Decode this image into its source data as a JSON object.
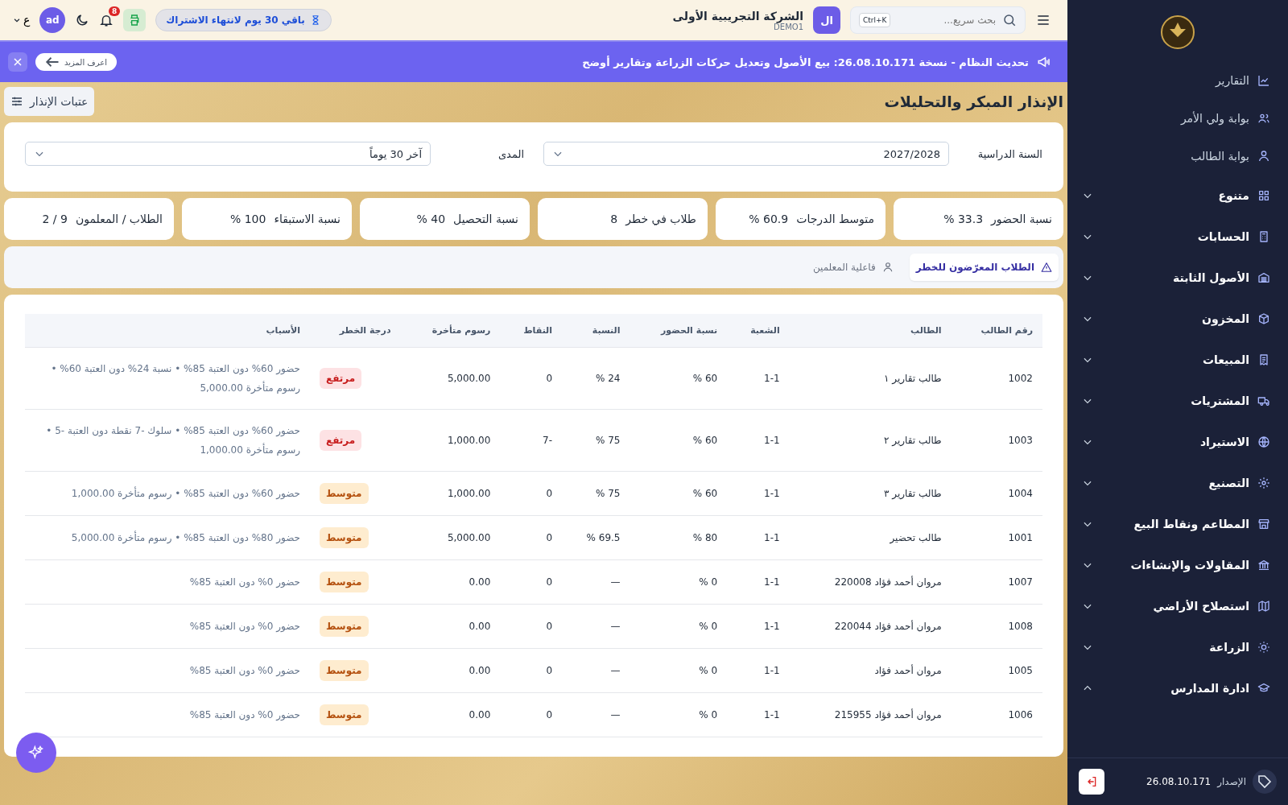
{
  "topbar": {
    "search": {
      "placeholder": "بحث سريع...",
      "shortcut": "Ctrl+K"
    },
    "company": {
      "initials": "ال",
      "name": "الشركة التجريبية الأولى",
      "code": "DEMO1"
    },
    "subscription": "باقي 30 يوم لانتهاء الاشتراك",
    "notifications": "8",
    "user": "ad",
    "language": "ع"
  },
  "banner": {
    "text": "تحديث النظام - نسخة 26.08.10.171: بيع الأصول وتعديل حركات الزراعة وتقارير أوضح",
    "more": "اعرف المزيد"
  },
  "page": {
    "title": "الإنذار المبكر والتحليلات",
    "thresholds_button": "عتبات الإنذار"
  },
  "filters": [
    {
      "label": "السنة الدراسية",
      "value": "2027/2028"
    },
    {
      "label": "المدى",
      "value": "آخر 30 يوماً"
    }
  ],
  "kpis": [
    {
      "label": "نسبة الحضور",
      "value": "33.3 %"
    },
    {
      "label": "متوسط الدرجات",
      "value": "60.9 %"
    },
    {
      "label": "طلاب في خطر",
      "value": "8"
    },
    {
      "label": "نسبة التحصيل",
      "value": "40 %"
    },
    {
      "label": "نسبة الاستبقاء",
      "value": "100 %"
    },
    {
      "label": "الطلاب / المعلمون",
      "value": "9 / 2"
    }
  ],
  "tabs": [
    {
      "label": "الطلاب المعرّضون للخطر",
      "selected": true,
      "kind": "warning"
    },
    {
      "label": "فاعلية المعلمين",
      "selected": false,
      "kind": "person"
    }
  ],
  "table": {
    "columns": [
      "رقم الطالب",
      "الطالب",
      "الشعبة",
      "نسبة الحضور",
      "النسبة",
      "النقاط",
      "رسوم متأخرة",
      "درجة الخطر",
      "الأسباب"
    ],
    "rows": [
      {
        "id": "1002",
        "student": "طالب تقارير ١",
        "section": "1-1",
        "attendance": "60 %",
        "ratio": "24 %",
        "points": "0",
        "late_fees": "5,000.00",
        "risk": {
          "label": "مرتفع",
          "kind": "high"
        },
        "reasons": "حضور 60% دون العتبة 85% • نسبة 24% دون العتبة 60% • رسوم متأخرة 5,000.00"
      },
      {
        "id": "1003",
        "student": "طالب تقارير ٢",
        "section": "1-1",
        "attendance": "60 %",
        "ratio": "75 %",
        "points": "-7",
        "late_fees": "1,000.00",
        "risk": {
          "label": "مرتفع",
          "kind": "high"
        },
        "reasons": "حضور 60% دون العتبة 85% • سلوك -7 نقطة دون العتبة -5 • رسوم متأخرة 1,000.00"
      },
      {
        "id": "1004",
        "student": "طالب تقارير ٣",
        "section": "1-1",
        "attendance": "60 %",
        "ratio": "75 %",
        "points": "0",
        "late_fees": "1,000.00",
        "risk": {
          "label": "متوسط",
          "kind": "medium"
        },
        "reasons": "حضور 60% دون العتبة 85% • رسوم متأخرة 1,000.00"
      },
      {
        "id": "1001",
        "student": "طالب تحضير",
        "section": "1-1",
        "attendance": "80 %",
        "ratio": "69.5 %",
        "points": "0",
        "late_fees": "5,000.00",
        "risk": {
          "label": "متوسط",
          "kind": "medium"
        },
        "reasons": "حضور 80% دون العتبة 85% • رسوم متأخرة 5,000.00"
      },
      {
        "id": "1007",
        "student": "مروان أحمد فؤاد 220008",
        "section": "1-1",
        "attendance": "0 %",
        "ratio": "—",
        "points": "0",
        "late_fees": "0.00",
        "risk": {
          "label": "متوسط",
          "kind": "medium"
        },
        "reasons": "حضور 0% دون العتبة 85%"
      },
      {
        "id": "1008",
        "student": "مروان أحمد فؤاد 220044",
        "section": "1-1",
        "attendance": "0 %",
        "ratio": "—",
        "points": "0",
        "late_fees": "0.00",
        "risk": {
          "label": "متوسط",
          "kind": "medium"
        },
        "reasons": "حضور 0% دون العتبة 85%"
      },
      {
        "id": "1005",
        "student": "مروان أحمد فؤاد",
        "section": "1-1",
        "attendance": "0 %",
        "ratio": "—",
        "points": "0",
        "late_fees": "0.00",
        "risk": {
          "label": "متوسط",
          "kind": "medium"
        },
        "reasons": "حضور 0% دون العتبة 85%"
      },
      {
        "id": "1006",
        "student": "مروان أحمد فؤاد 215955",
        "section": "1-1",
        "attendance": "0 %",
        "ratio": "—",
        "points": "0",
        "late_fees": "0.00",
        "risk": {
          "label": "متوسط",
          "kind": "medium"
        },
        "reasons": "حضور 0% دون العتبة 85%"
      }
    ]
  },
  "sidebar": {
    "links": [
      {
        "label": "التقارير",
        "kind": "chart"
      },
      {
        "label": "بوابة ولي الأمر",
        "kind": "users"
      },
      {
        "label": "بوابة الطالب",
        "kind": "user"
      }
    ],
    "sections": [
      {
        "label": "متنوع",
        "kind": "grid",
        "expanded": false
      },
      {
        "label": "الحسابات",
        "kind": "calculator",
        "expanded": false
      },
      {
        "label": "الأصول الثابتة",
        "kind": "warehouse",
        "expanded": false
      },
      {
        "label": "المخزون",
        "kind": "box",
        "expanded": false
      },
      {
        "label": "المبيعات",
        "kind": "receipt",
        "expanded": false
      },
      {
        "label": "المشتريات",
        "kind": "truck",
        "expanded": false
      },
      {
        "label": "الاستيراد",
        "kind": "globe",
        "expanded": false
      },
      {
        "label": "التصنيع",
        "kind": "gear",
        "expanded": false
      },
      {
        "label": "المطاعم ونقاط البيع",
        "kind": "store",
        "expanded": false
      },
      {
        "label": "المقاولات والإنشاءات",
        "kind": "bank",
        "expanded": false
      },
      {
        "label": "استصلاح الأراضي",
        "kind": "map",
        "expanded": false
      },
      {
        "label": "الزراعة",
        "kind": "sun",
        "expanded": false
      },
      {
        "label": "ادارة المدارس",
        "kind": "cap",
        "expanded": true
      }
    ],
    "version_label": "الإصدار",
    "version": "26.08.10.171"
  }
}
